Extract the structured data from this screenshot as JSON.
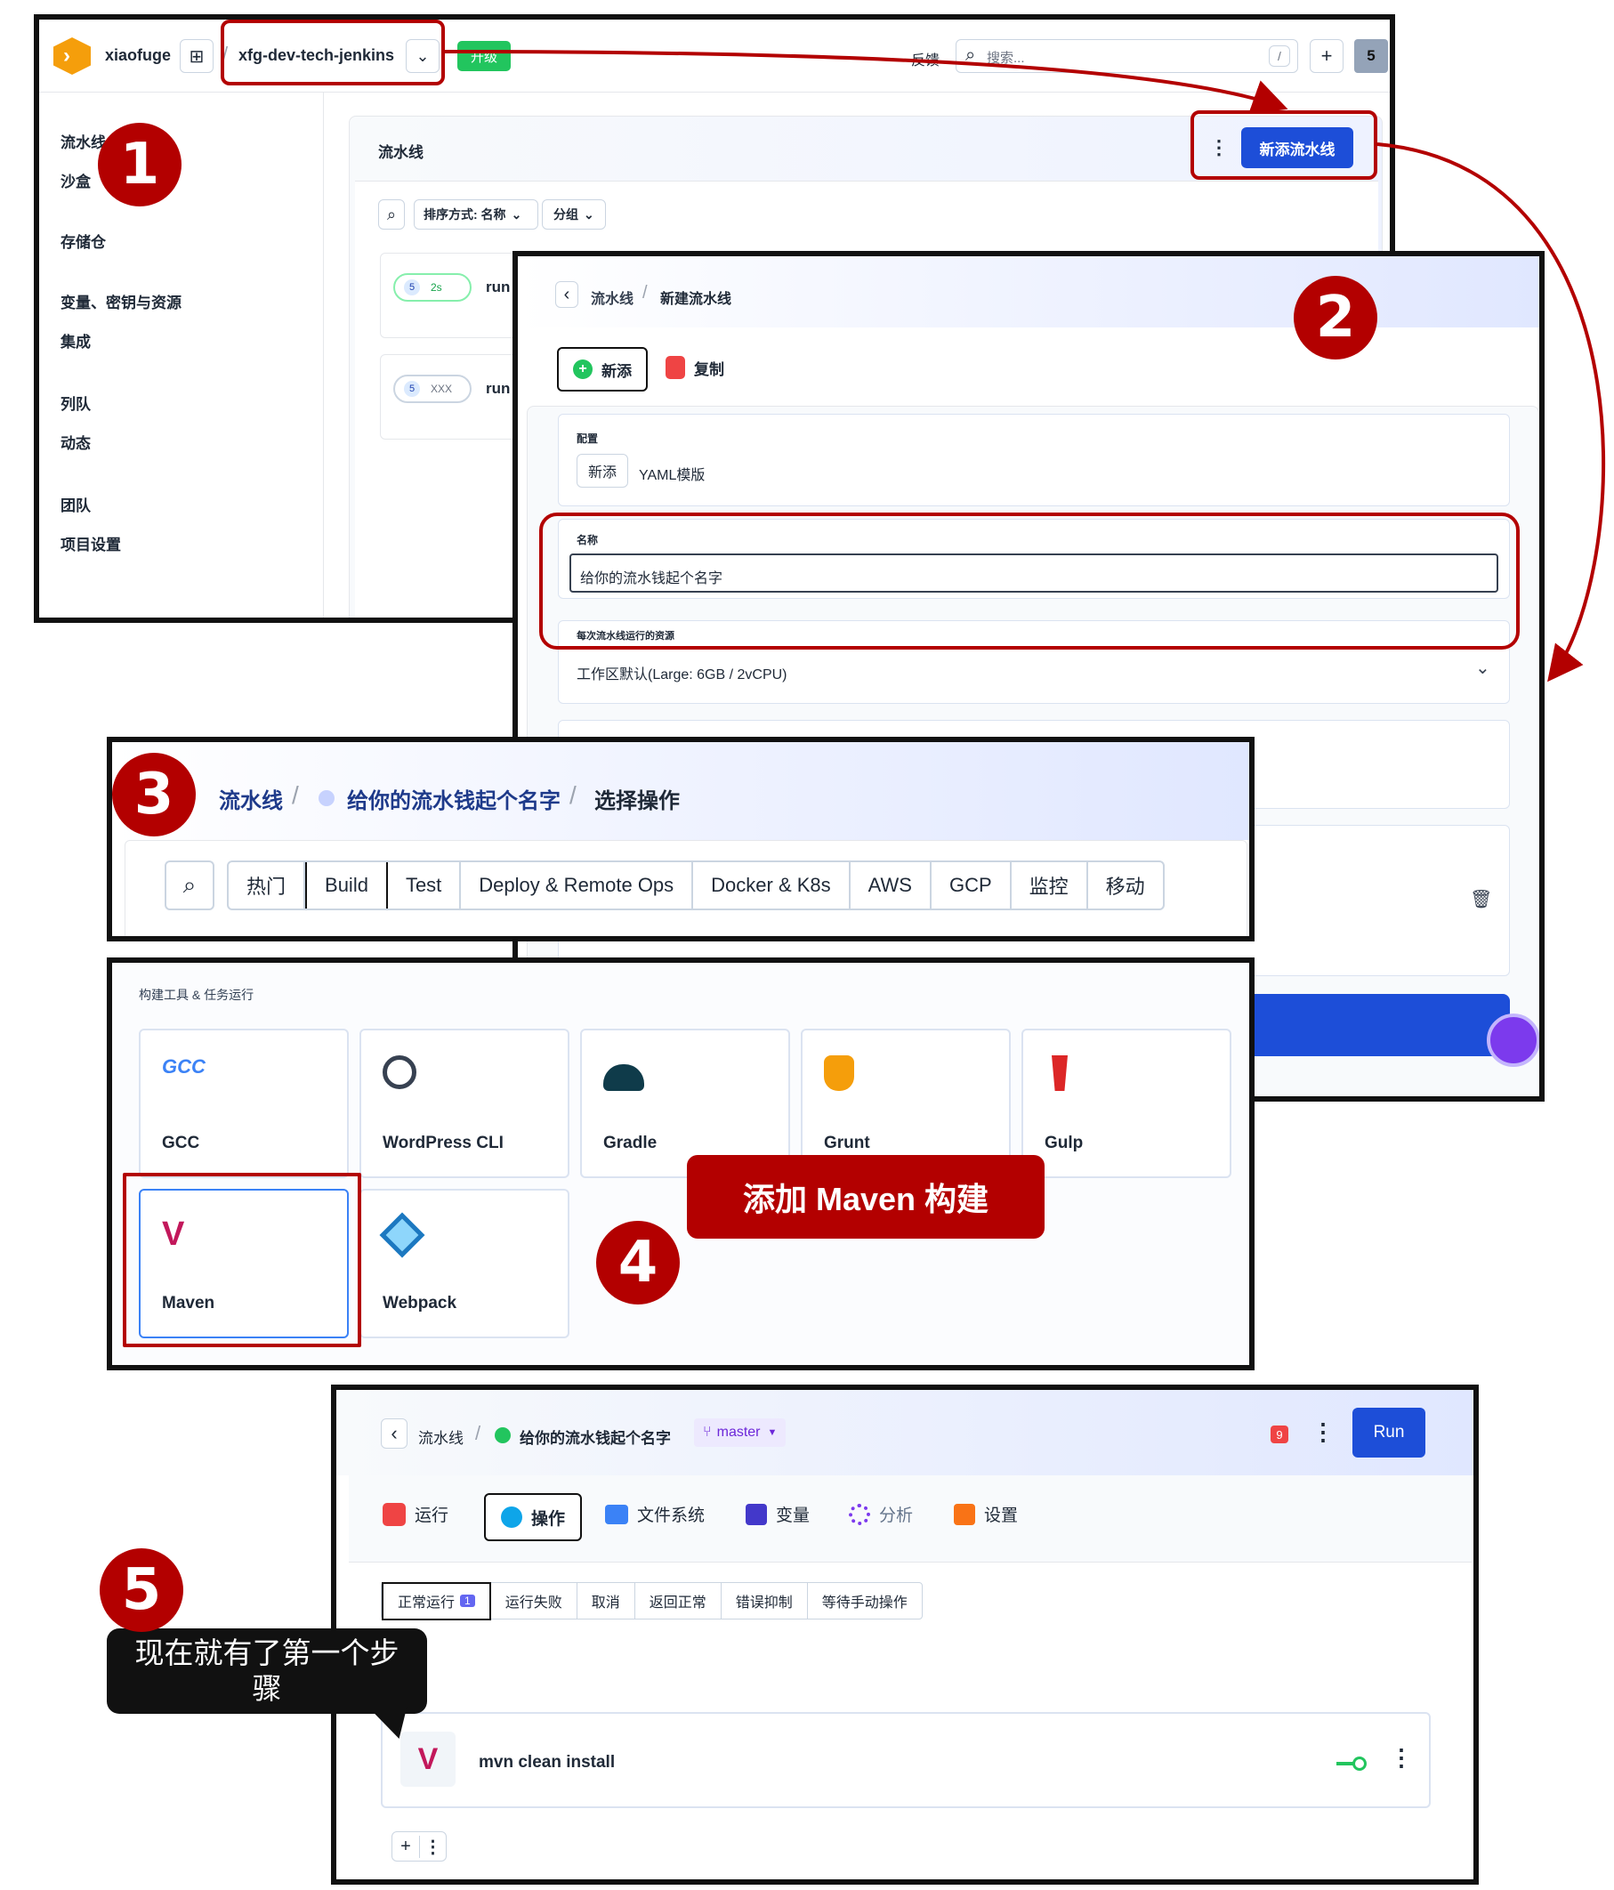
{
  "panel1": {
    "user": "xiaofuge",
    "project": "xfg-dev-tech-jenkins",
    "upgrade": "升级",
    "feedback": "反馈",
    "search_placeholder": "搜索...",
    "search_shortcut": "/",
    "plus": "+",
    "avatar": "5",
    "sidebar": [
      "流水线",
      "沙盒",
      "存储仓",
      "变量、密钥与资源",
      "集成",
      "列队",
      "动态",
      "团队",
      "项目设置"
    ],
    "main_title": "流水线",
    "more": "⋮",
    "new_pipeline": "新添流水线",
    "sort": "排序方式: 名称",
    "group": "分组",
    "rows": [
      {
        "tag": "2s",
        "num": "5",
        "name": "run"
      },
      {
        "tag": "XXX",
        "num": "5",
        "name": "run"
      }
    ]
  },
  "panel2": {
    "breadcrumb_root": "流水线",
    "breadcrumb_current": "新建流水线",
    "tab_new": "新添",
    "tab_copy": "复制",
    "config_label": "配置",
    "config_new": "新添",
    "config_yaml": "YAML模版",
    "name_label": "名称",
    "name_value": "给你的流水钱起个名字",
    "resource_label": "每次流水线运行的资源",
    "resource_value": "工作区默认(Large: 6GB / 2vCPU)"
  },
  "panel3": {
    "crumb1": "流水线",
    "crumb2": "给你的流水钱起个名字",
    "crumb3": "选择操作",
    "tabs": [
      "热门",
      "Build",
      "Test",
      "Deploy & Remote Ops",
      "Docker & K8s",
      "AWS",
      "GCP",
      "监控",
      "移动"
    ],
    "selected_tab": "Build"
  },
  "panel4": {
    "section": "构建工具 & 任务运行",
    "tools": [
      "GCC",
      "WordPress CLI",
      "Gradle",
      "Grunt",
      "Gulp",
      "Maven",
      "Webpack"
    ],
    "callout": "添加 Maven 构建"
  },
  "panel5": {
    "crumb1": "流水线",
    "crumb2": "给你的流水钱起个名字",
    "branch": "master",
    "notif": "9",
    "run": "Run",
    "tabs": [
      "运行",
      "操作",
      "文件系统",
      "变量",
      "分析",
      "设置"
    ],
    "filters": [
      "正常运行",
      "运行失败",
      "取消",
      "返回正常",
      "错误抑制",
      "等待手动操作"
    ],
    "filter_count": "1",
    "step": "mvn clean install",
    "add": "+",
    "dots": "⋮"
  },
  "bubble": "现在就有了第一个步骤",
  "badges": [
    "1",
    "2",
    "3",
    "4",
    "5"
  ],
  "colors": {
    "annotation_red": "#b30000",
    "primary_blue": "#1d4ed8",
    "upgrade_green": "#22c55e"
  }
}
